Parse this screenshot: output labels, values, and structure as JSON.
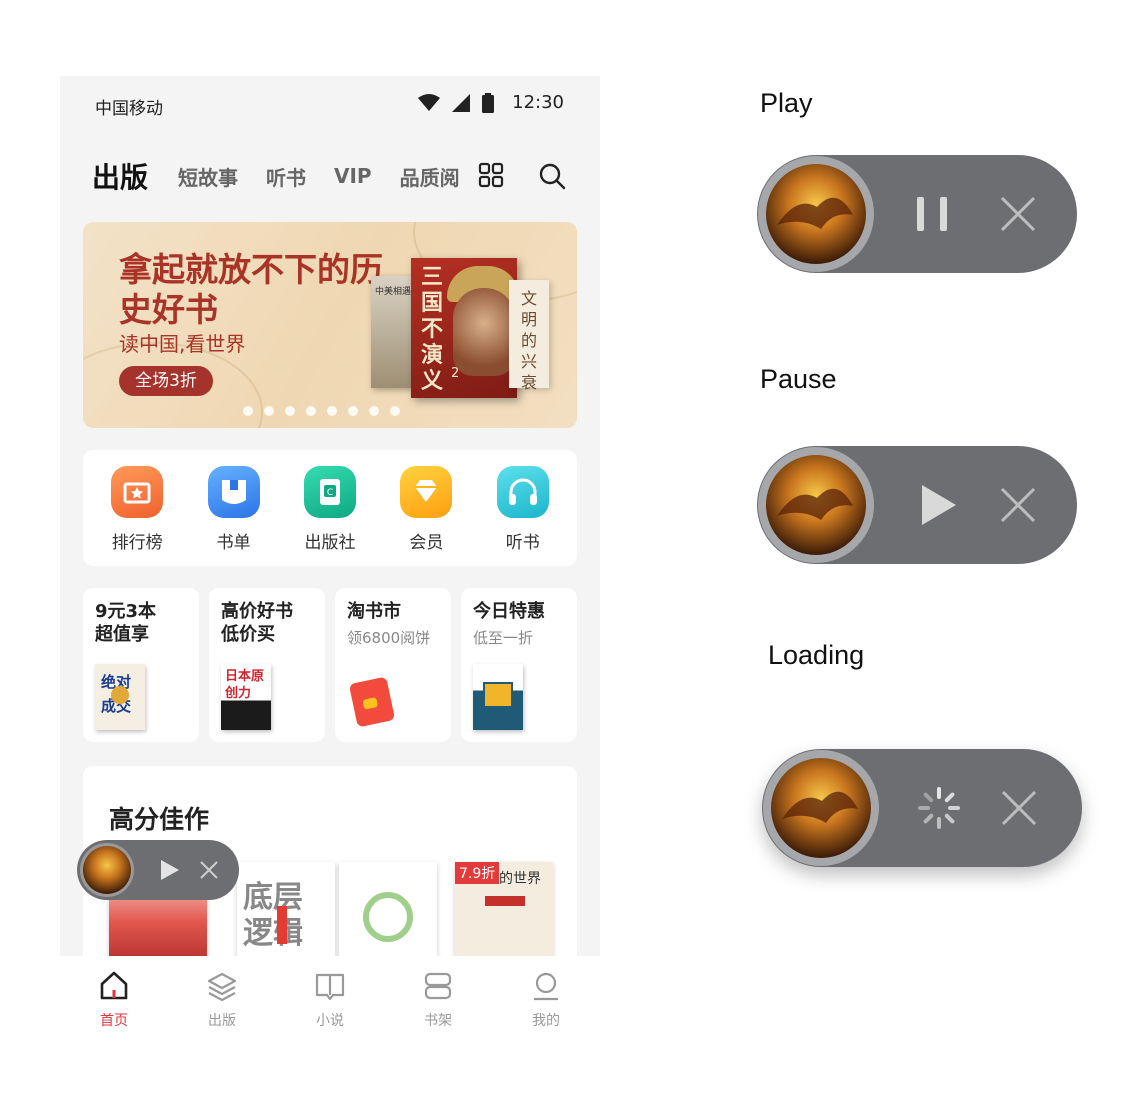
{
  "status_bar": {
    "carrier": "中国移动",
    "time": "12:30"
  },
  "top_tabs": [
    "出版",
    "短故事",
    "听书",
    "VIP",
    "品质阅"
  ],
  "banner": {
    "title": "拿起就放不下的历史好书",
    "subtitle": "读中国,看世界",
    "button": "全场3折",
    "book_left_label": "中美相遇",
    "book_main_title": "三国不演义",
    "book_main_volume": "2",
    "book_right_title": "文明的兴衰",
    "page_count": 8,
    "active_page": 1
  },
  "shortcuts": [
    {
      "label": "排行榜",
      "icon": "ranking-icon",
      "color": "#f47a3c"
    },
    {
      "label": "书单",
      "icon": "booklist-icon",
      "color": "#3f8ef2"
    },
    {
      "label": "出版社",
      "icon": "publisher-icon",
      "color": "#16c49a"
    },
    {
      "label": "会员",
      "icon": "vip-diamond-icon",
      "color": "#ffb51c"
    },
    {
      "label": "听书",
      "icon": "headphones-icon",
      "color": "#2fc7d9"
    }
  ],
  "cards": [
    {
      "title_line1": "9元3本",
      "title_line2": "超值享",
      "subtitle": "",
      "book_text": "绝对成交"
    },
    {
      "title_line1": "高价好书",
      "title_line2": "低价买",
      "subtitle": "",
      "book_text": "日本原创力"
    },
    {
      "title_line1": "淘书市",
      "title_line2": "",
      "subtitle": "领6800阅饼",
      "book_text": ""
    },
    {
      "title_line1": "今日特惠",
      "title_line2": "",
      "subtitle": "低至一折",
      "book_text": ""
    }
  ],
  "high_score": {
    "title": "高分佳作",
    "books": [
      {
        "text": ""
      },
      {
        "text": "底层逻辑"
      },
      {
        "text": ""
      },
      {
        "text": "的世界",
        "badge": "7.9折"
      }
    ]
  },
  "bottom_nav": [
    {
      "label": "首页",
      "icon": "home-icon",
      "active": true
    },
    {
      "label": "出版",
      "icon": "layers-icon",
      "active": false
    },
    {
      "label": "小说",
      "icon": "book-icon",
      "active": false
    },
    {
      "label": "书架",
      "icon": "bookshelf-icon",
      "active": false
    },
    {
      "label": "我的",
      "icon": "profile-icon",
      "active": false
    }
  ],
  "player_states": [
    {
      "label": "Play",
      "control": "pause-icon"
    },
    {
      "label": "Pause",
      "control": "play-icon"
    },
    {
      "label": "Loading",
      "control": "loading-spinner-icon"
    }
  ],
  "colors": {
    "accent": "#e2373f",
    "player_bg": "#6c6e72",
    "banner_red": "#a93327"
  }
}
